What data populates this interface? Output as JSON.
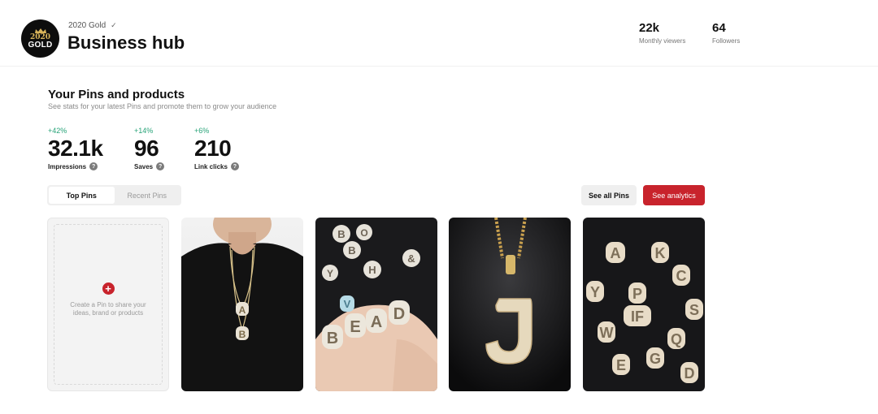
{
  "header": {
    "account_name": "2020 Gold",
    "title": "Business hub",
    "avatar_year": "2020",
    "avatar_word": "GOLD",
    "stats": [
      {
        "value": "22k",
        "label": "Monthly viewers"
      },
      {
        "value": "64",
        "label": "Followers"
      }
    ]
  },
  "section": {
    "title": "Your Pins and products",
    "subtitle": "See stats for your latest Pins and promote them to grow your audience"
  },
  "metrics": [
    {
      "delta": "+42%",
      "value": "32.1k",
      "label": "Impressions"
    },
    {
      "delta": "+14%",
      "value": "96",
      "label": "Saves"
    },
    {
      "delta": "+6%",
      "value": "210",
      "label": "Link clicks"
    }
  ],
  "tabs": {
    "top": "Top Pins",
    "recent": "Recent Pins",
    "active": "Top Pins"
  },
  "buttons": {
    "see_all": "See all Pins",
    "see_analytics": "See analytics"
  },
  "create_card": {
    "text": "Create a Pin to share your ideas, brand or products"
  },
  "pins": [
    {
      "icon": "pendant-necklace-photo"
    },
    {
      "icon": "bubble-letter-pendants-hand-photo"
    },
    {
      "icon": "letter-j-pendant-photo"
    },
    {
      "icon": "scattered-letter-pendants-photo"
    }
  ],
  "colors": {
    "accent": "#c8232c",
    "positive": "#27a378"
  }
}
